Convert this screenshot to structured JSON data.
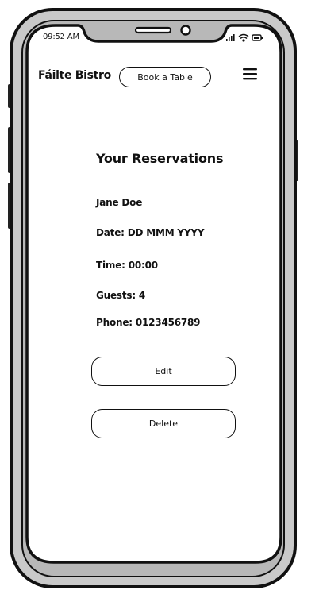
{
  "status_bar": {
    "time": "09:52 AM"
  },
  "header": {
    "brand": "Fáilte Bistro",
    "book_label": "Book a Table"
  },
  "reservation": {
    "title": "Your Reservations",
    "name": "Jane Doe",
    "date": "Date: DD MMM YYYY",
    "time": "Time: 00:00",
    "guests": "Guests: 4",
    "phone": "Phone: 0123456789"
  },
  "actions": {
    "edit_label": "Edit",
    "delete_label": "Delete"
  },
  "icons": [
    "menu-icon",
    "signal-icon",
    "wifi-icon",
    "battery-icon",
    "camera-icon",
    "speaker-icon"
  ]
}
